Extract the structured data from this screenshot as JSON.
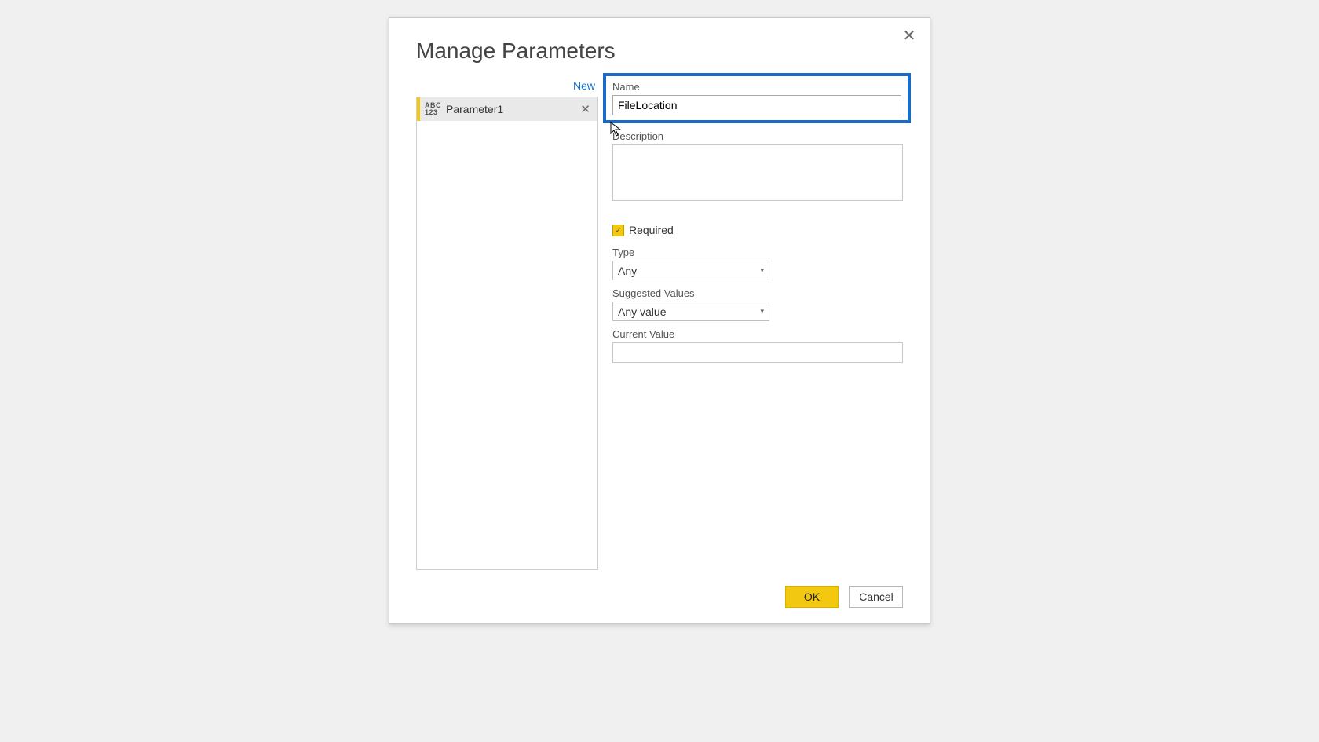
{
  "dialog": {
    "title": "Manage Parameters",
    "new_link": "New",
    "close_glyph": "✕"
  },
  "params": {
    "items": [
      {
        "label": "Parameter1"
      }
    ],
    "delete_glyph": "✕"
  },
  "form": {
    "name_label": "Name",
    "name_value": "FileLocation",
    "description_label": "Description",
    "description_value": "",
    "required_label": "Required",
    "required_check_glyph": "✓",
    "type_label": "Type",
    "type_value": "Any",
    "suggested_label": "Suggested Values",
    "suggested_value": "Any value",
    "current_label": "Current Value",
    "current_value": "",
    "caret": "▾"
  },
  "footer": {
    "ok": "OK",
    "cancel": "Cancel"
  }
}
